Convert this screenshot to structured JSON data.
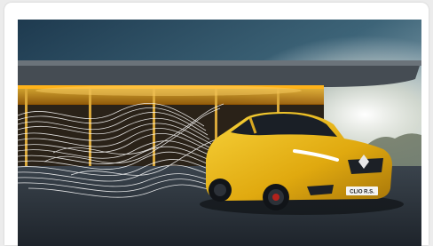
{
  "card": {
    "image": {
      "subject": "yellow-hatchback-car",
      "plate_text": "CLIO R.S.",
      "colors": {
        "sky_top": "#27465c",
        "sky_bottom": "#dfe8ea",
        "canopy": "#3a4148",
        "light_strip": "#ffb31a",
        "ground": "#2b333c",
        "car_body": "#f2c21b",
        "airflow_lines": "#ffffff"
      }
    }
  }
}
